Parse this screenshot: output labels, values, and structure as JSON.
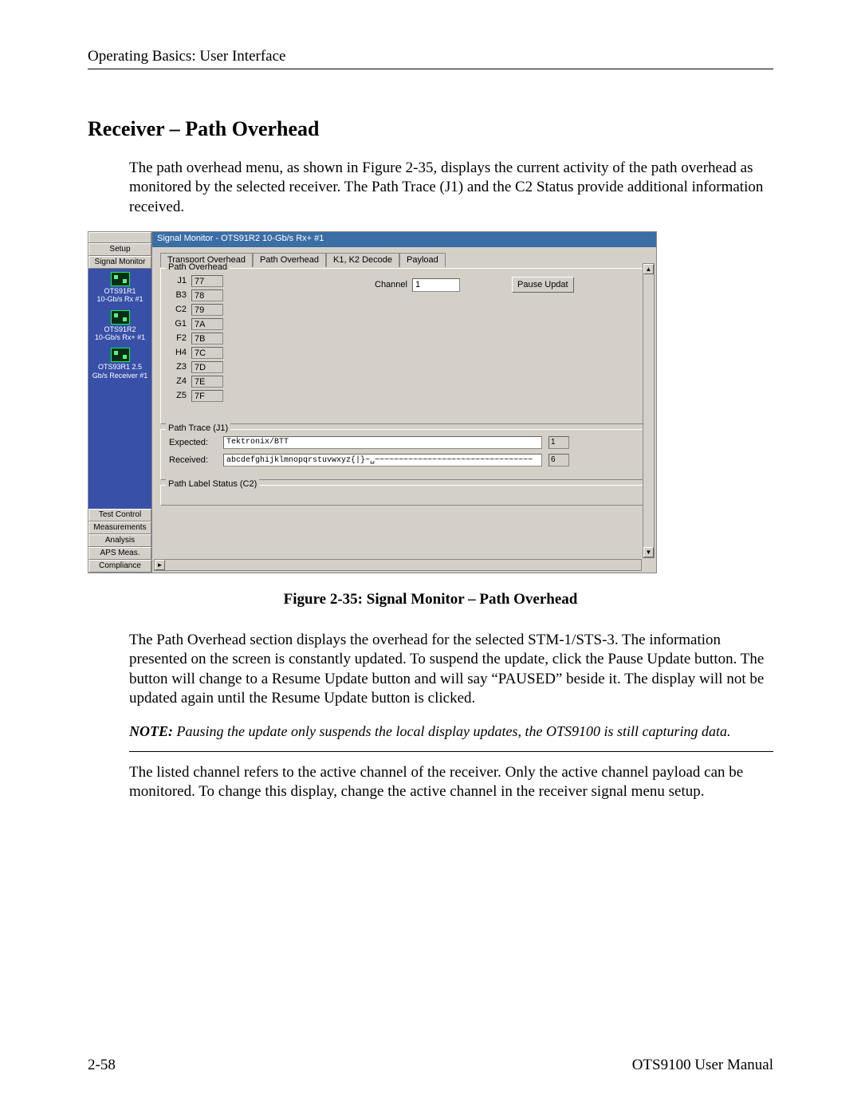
{
  "doc": {
    "header": "Operating Basics: User Interface",
    "section_title": "Receiver – Path Overhead",
    "intro": "The path overhead menu, as shown in Figure 2-35, displays the current activity of the path overhead as monitored by the selected receiver.  The Path Trace (J1) and the C2 Status provide additional information received.",
    "caption": "Figure 2-35: Signal Monitor – Path Overhead",
    "para2": "The Path Overhead section displays the overhead for the selected STM-1/STS-3.  The information presented on the screen is constantly updated.  To suspend the update, click the Pause Update button.  The button will change to a Resume Update button and will say “PAUSED” beside it.  The display will not be updated again until the Resume Update button is clicked.",
    "note_label": "NOTE:",
    "note_body": " Pausing the update only suspends the local display updates, the OTS9100 is still capturing data.",
    "para3": "The listed channel refers to the active channel of the receiver.  Only the active channel payload can be monitored.  To change this display, change the active channel in the receiver signal menu setup.",
    "page_num": "2-58",
    "manual": "OTS9100 User Manual"
  },
  "app": {
    "sidebar": {
      "setup": "Setup",
      "signal_monitor": "Signal Monitor",
      "devices": [
        {
          "name": "OTS91R1",
          "sub": "10-Gb/s Rx #1"
        },
        {
          "name": "OTS91R2",
          "sub": "10-Gb/s Rx+ #1"
        },
        {
          "name": "OTS93R1 2.5",
          "sub": "Gb/s Receiver #1"
        }
      ],
      "bottom": [
        "Test Control",
        "Measurements",
        "Analysis",
        "APS Meas.",
        "Compliance"
      ]
    },
    "titlebar": "Signal Monitor - OTS91R2 10-Gb/s Rx+ #1",
    "tabs": [
      "Transport Overhead",
      "Path Overhead",
      "K1, K2 Decode",
      "Payload"
    ],
    "active_tab": 1,
    "path_overhead": {
      "legend": "Path Overhead",
      "rows": [
        {
          "k": "J1",
          "v": "77"
        },
        {
          "k": "B3",
          "v": "78"
        },
        {
          "k": "C2",
          "v": "79"
        },
        {
          "k": "G1",
          "v": "7A"
        },
        {
          "k": "F2",
          "v": "7B"
        },
        {
          "k": "H4",
          "v": "7C"
        },
        {
          "k": "Z3",
          "v": "7D"
        },
        {
          "k": "Z4",
          "v": "7E"
        },
        {
          "k": "Z5",
          "v": "7F"
        }
      ],
      "channel_label": "Channel",
      "channel_value": "1",
      "pause_label": "Pause Updat"
    },
    "path_trace": {
      "legend": "Path Trace (J1)",
      "expected_label": "Expected:",
      "expected_value": "Tektronix/BTT",
      "expected_n": "1",
      "received_label": "Received:",
      "received_value": "abcdefghijklmnopqrstuvwxyz{|}~␣~~~~~~~~~~~~~~~~~~~~~~~~~~~~~~~~~",
      "received_n": "6"
    },
    "path_label_status": {
      "legend": "Path Label Status (C2)"
    }
  }
}
